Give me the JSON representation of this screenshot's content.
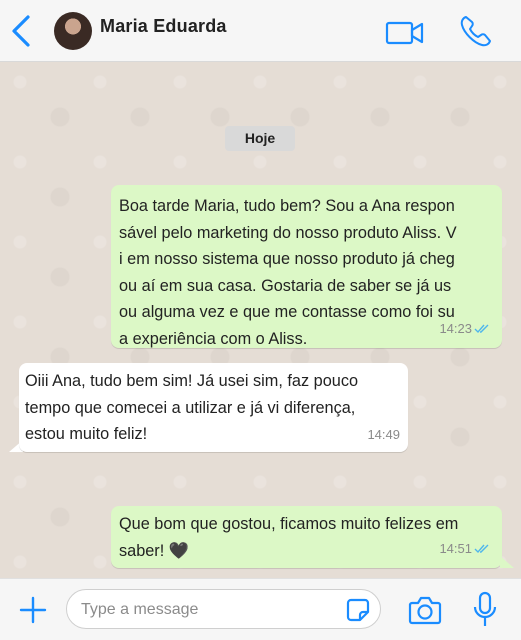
{
  "header": {
    "contact_name": "Maria Eduarda",
    "back_icon": "back-chevron-icon",
    "video_icon": "video-call-icon",
    "phone_icon": "phone-call-icon"
  },
  "chat": {
    "date_label": "Hoje",
    "messages": [
      {
        "direction": "outgoing",
        "text": "Boa tarde Maria, tudo bem? Sou a Ana respon\nsável pelo marketing do nosso produto Aliss. V\ni em nosso sistema que nosso produto já cheg\nou aí em sua casa. Gostaria de saber se já us\nou alguma vez e que me contasse como foi su\na experiência com o Aliss.",
        "time": "14:23",
        "status": "read"
      },
      {
        "direction": "incoming",
        "text": "Oiii Ana, tudo bem sim! Já usei sim, faz pouco\ntempo que comecei a utilizar e já vi diferença,\nestou muito feliz!",
        "time": "14:49"
      },
      {
        "direction": "outgoing",
        "text": "Que bom que gostou, ficamos muito felizes em\nsaber! 🖤",
        "time": "14:51",
        "status": "read"
      }
    ]
  },
  "footer": {
    "input_placeholder": "Type a message",
    "input_value": "",
    "plus_icon": "plus-icon",
    "sticker_icon": "sticker-icon",
    "camera_icon": "camera-icon",
    "mic_icon": "microphone-icon"
  },
  "colors": {
    "accent": "#1a8cff",
    "outgoing_bubble": "#dcf8c6",
    "incoming_bubble": "#ffffff",
    "chat_background": "#e5ddd5",
    "read_ticks": "#4fb6ec"
  }
}
